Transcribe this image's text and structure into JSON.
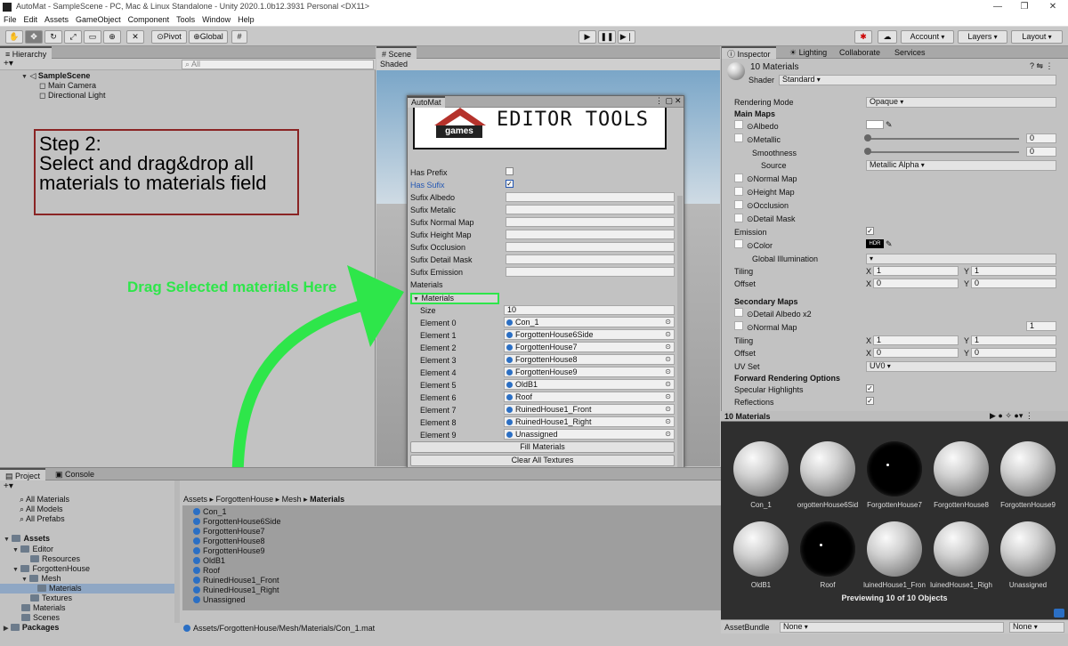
{
  "window": {
    "title": "AutoMat - SampleScene - PC, Mac & Linux Standalone - Unity 2020.1.0b12.3931 Personal <DX11>",
    "min": "—",
    "max": "❐",
    "close": "✕"
  },
  "menu": [
    "File",
    "Edit",
    "Assets",
    "GameObject",
    "Component",
    "Tools",
    "Window",
    "Help"
  ],
  "toolbar": {
    "pivot": "Pivot",
    "global": "Global",
    "account": "Account",
    "layers": "Layers",
    "layout": "Layout"
  },
  "hierarchy": {
    "tab": "Hierarchy",
    "search_placeholder": "All",
    "scene": "SampleScene",
    "items": [
      "Main Camera",
      "Directional Light"
    ]
  },
  "scene": {
    "tab": "Scene",
    "shading": "Shaded"
  },
  "annotation": {
    "step_line1": "Step 2:",
    "step_line2": "Select and drag&drop all",
    "step_line3": "materials to materials field",
    "drag_text": "Drag Selected materials Here"
  },
  "automat": {
    "tab": "AutoMat",
    "logo_text": "games",
    "banner": "EDITOR TOOLS",
    "has_prefix": "Has Prefix",
    "has_sufix": "Has Sufix",
    "fields": [
      "Sufix Albedo",
      "Sufix Metalic",
      "Sufix Normal Map",
      "Sufix Height Map",
      "Sufix Occlusion",
      "Sufix Detail Mask",
      "Sufix Emission"
    ],
    "materials_label": "Materials",
    "materials_foldout": "Materials",
    "size_label": "Size",
    "size_value": "10",
    "elements": [
      {
        "label": "Element 0",
        "value": "Con_1"
      },
      {
        "label": "Element 1",
        "value": "ForgottenHouse6Side"
      },
      {
        "label": "Element 2",
        "value": "ForgottenHouse7"
      },
      {
        "label": "Element 3",
        "value": "ForgottenHouse8"
      },
      {
        "label": "Element 4",
        "value": "ForgottenHouse9"
      },
      {
        "label": "Element 5",
        "value": "OldB1"
      },
      {
        "label": "Element 6",
        "value": "Roof"
      },
      {
        "label": "Element 7",
        "value": "RuinedHouse1_Front"
      },
      {
        "label": "Element 8",
        "value": "RuinedHouse1_Right"
      },
      {
        "label": "Element 9",
        "value": "Unassigned"
      }
    ],
    "fill_button": "Fill Materials",
    "clear_button": "Clear All Textures"
  },
  "inspector": {
    "tabs": [
      "Inspector",
      "Lighting",
      "Collaborate",
      "Services"
    ],
    "title": "10 Materials",
    "shader_label": "Shader",
    "shader_value": "Standard",
    "rendering_mode_label": "Rendering Mode",
    "rendering_mode_value": "Opaque",
    "main_maps": "Main Maps",
    "albedo": "Albedo",
    "metallic": "Metallic",
    "metallic_value": "0",
    "smoothness": "Smoothness",
    "smoothness_value": "0",
    "source": "Source",
    "source_value": "Metallic Alpha",
    "normal_map": "Normal Map",
    "height_map": "Height Map",
    "occlusion": "Occlusion",
    "detail_mask": "Detail Mask",
    "emission": "Emission",
    "color": "Color",
    "hdr": "HDR",
    "global_illum": "Global Illumination",
    "tiling": "Tiling",
    "offset": "Offset",
    "x": "X",
    "y": "Y",
    "tiling_x": "1",
    "tiling_y": "1",
    "offset_x": "0",
    "offset_y": "0",
    "secondary_maps": "Secondary Maps",
    "detail_albedo": "Detail Albedo x2",
    "normal_map2": "Normal Map",
    "normal_map2_value": "1",
    "tiling2_x": "1",
    "tiling2_y": "1",
    "offset2_x": "0",
    "offset2_y": "0",
    "uv_set": "UV Set",
    "uv_set_value": "UV0",
    "forward_opts": "Forward Rendering Options",
    "specular": "Specular Highlights",
    "reflections": "Reflections"
  },
  "preview": {
    "title": "10 Materials",
    "names": [
      "Con_1",
      "orgottenHouse6Sid",
      "ForgottenHouse7",
      "ForgottenHouse8",
      "ForgottenHouse9",
      "OldB1",
      "Roof",
      "luinedHouse1_Fron",
      "luinedHouse1_Righ",
      "Unassigned"
    ],
    "footer": "Previewing 10 of 10 Objects"
  },
  "asset_bundle": {
    "label": "AssetBundle",
    "value": "None",
    "variant": "None"
  },
  "project": {
    "tabs": [
      "Project",
      "Console"
    ],
    "favorites": [
      "All Materials",
      "All Models",
      "All Prefabs"
    ],
    "assets_label": "Assets",
    "tree": [
      "Editor",
      "Resources",
      "ForgottenHouse",
      "Mesh",
      "Materials",
      "Textures",
      "Materials",
      "Scenes"
    ],
    "packages": "Packages",
    "breadcrumb": [
      "Assets",
      "ForgottenHouse",
      "Mesh",
      "Materials"
    ],
    "files": [
      "Con_1",
      "ForgottenHouse6Side",
      "ForgottenHouse7",
      "ForgottenHouse8",
      "ForgottenHouse9",
      "OldB1",
      "Roof",
      "RuinedHouse1_Front",
      "RuinedHouse1_Right",
      "Unassigned"
    ],
    "status_path": "Assets/ForgottenHouse/Mesh/Materials/Con_1.mat"
  }
}
